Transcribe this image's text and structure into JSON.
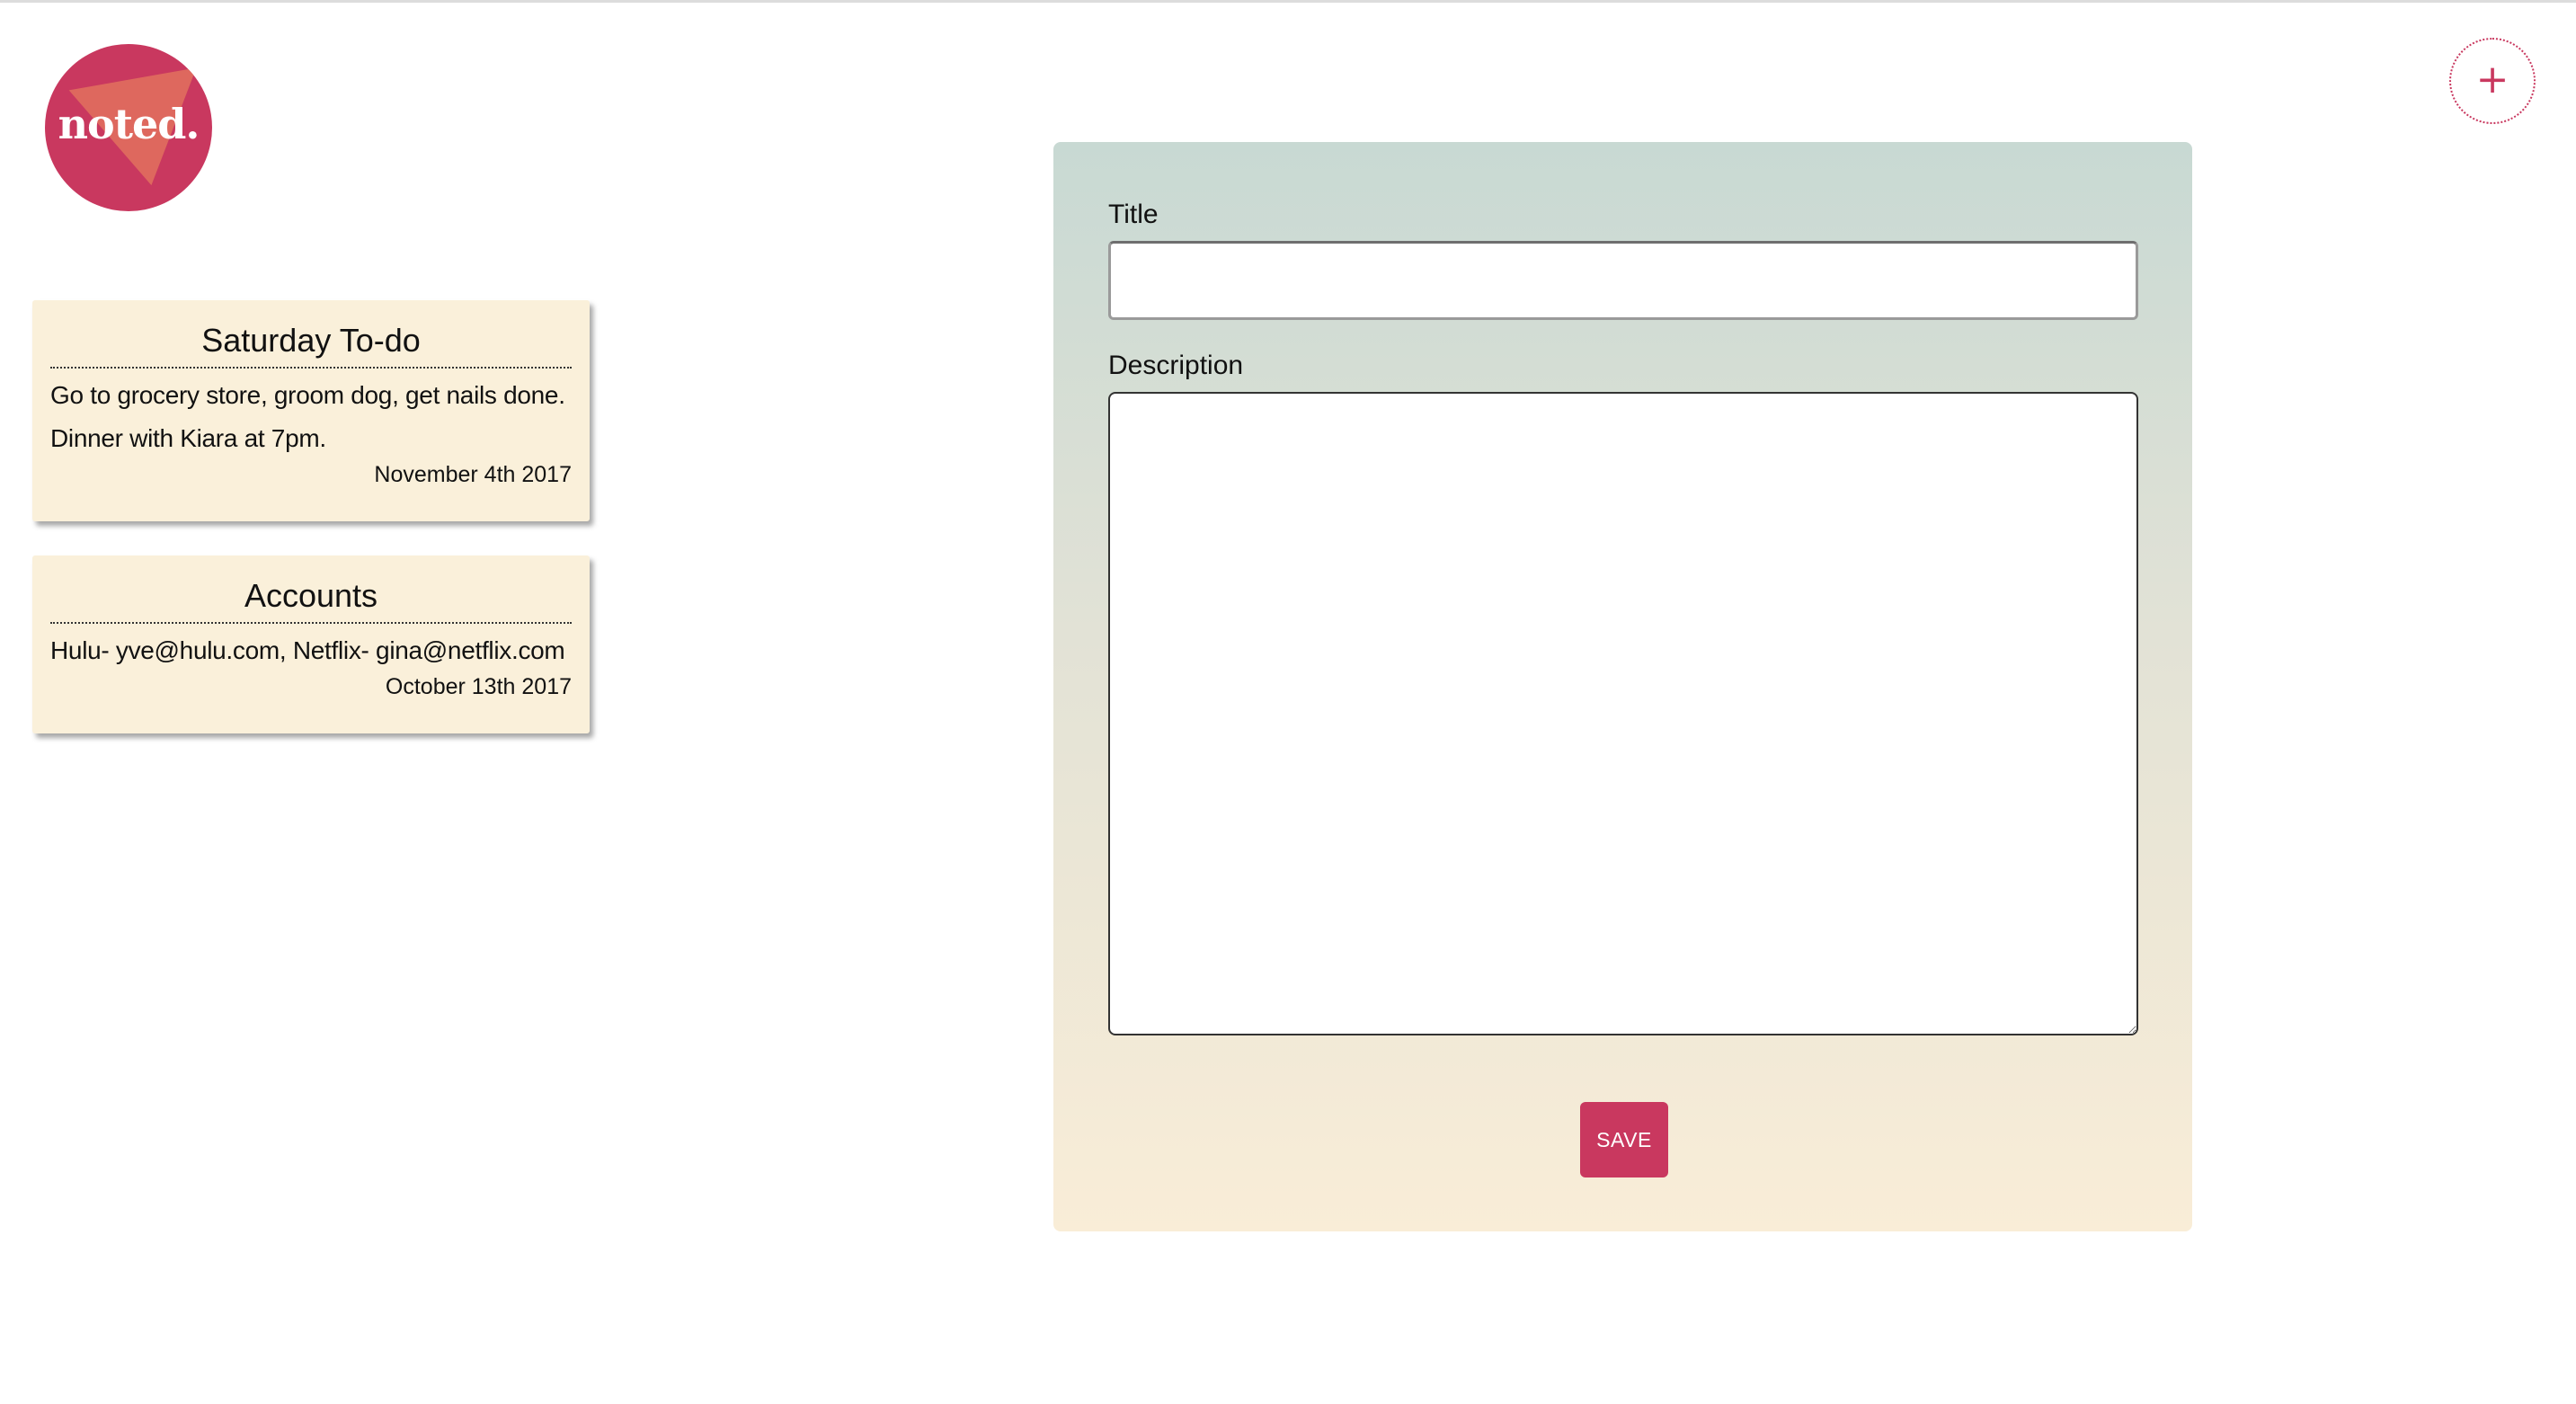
{
  "app": {
    "logo_text": "noted.",
    "brand_color": "#c9385f",
    "logo_accent_color": "#df6a5e"
  },
  "header": {
    "add_button_icon": "plus-icon",
    "add_button_label": "+"
  },
  "notes": [
    {
      "title": "Saturday To-do",
      "description": "Go to grocery store, groom dog, get nails done. Dinner with Kiara at 7pm.",
      "date": "November 4th 2017"
    },
    {
      "title": "Accounts",
      "description": "Hulu- yve@hulu.com, Netflix- gina@netflix.com",
      "date": "October 13th 2017"
    }
  ],
  "form": {
    "title_label": "Title",
    "title_value": "",
    "description_label": "Description",
    "description_value": "",
    "save_label": "SAVE",
    "card_color": "#faf0da"
  }
}
